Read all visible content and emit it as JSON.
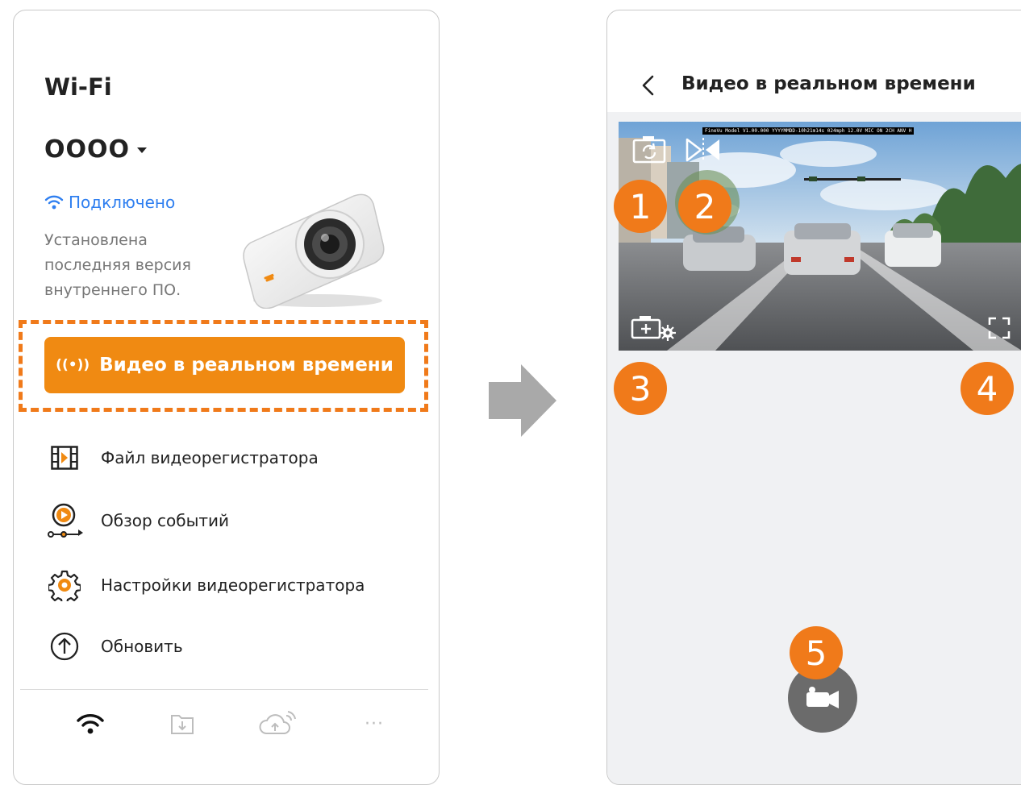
{
  "left": {
    "wifi_title": "Wi-Fi",
    "ssid": "OOOO",
    "status": "Подключено",
    "firmware_note": "Установлена последняя версия внутреннего ПО.",
    "live_button": "Видео в реальном времени",
    "live_button_icon": "((•))",
    "menu": [
      {
        "label": "Файл видеорегистратора",
        "icon": "film-icon"
      },
      {
        "label": "Обзор событий",
        "icon": "event-review-icon"
      },
      {
        "label": "Настройки видеорегистратора",
        "icon": "settings-gear-icon"
      },
      {
        "label": "Обновить",
        "icon": "upload-arrow-icon"
      }
    ],
    "tabs": [
      "wifi-icon",
      "download-folder-icon",
      "cloud-upload-icon",
      "more-icon"
    ],
    "more_label": "···"
  },
  "right": {
    "title": "Видео в реальном времени",
    "osd_text": "FineVu Model V1.00.000 YYYYMMDD-10h21m14s 024mph 12.0V MIC ON 2CH ANV H",
    "callouts": [
      "1",
      "2",
      "3",
      "4",
      "5"
    ]
  },
  "colors": {
    "accent": "#f08a12",
    "dash": "#f07a1a",
    "status": "#2f7ff0",
    "callout": "#f07a1a"
  }
}
